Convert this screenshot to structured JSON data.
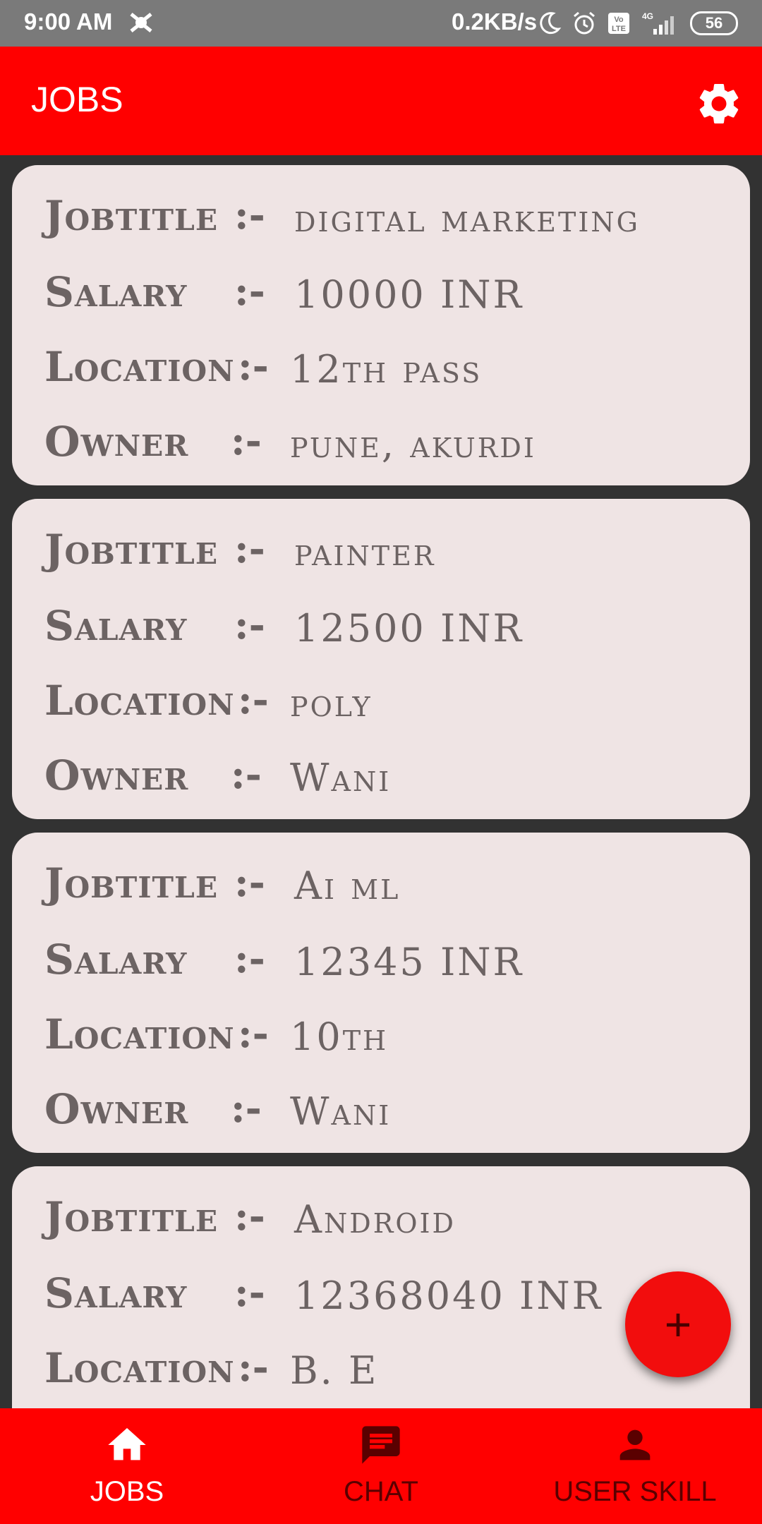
{
  "status_bar": {
    "time": "9:00 AM",
    "speed": "0.2KB/s",
    "battery": "56",
    "network": "4G"
  },
  "app_bar": {
    "title": "JOBS"
  },
  "labels": {
    "jobtitle": "Jobtitle",
    "salary": "Salary",
    "location": "Location",
    "owner": "Owner",
    "separator": ":-"
  },
  "jobs": [
    {
      "jobtitle": "digital marketing",
      "salary": "10000  INR",
      "location": "12th pass",
      "owner": "pune, akurdi"
    },
    {
      "jobtitle": "painter",
      "salary": "12500  INR",
      "location": "poly",
      "owner": "Wani"
    },
    {
      "jobtitle": "Ai ml",
      "salary": "12345  INR",
      "location": "10th",
      "owner": "Wani"
    },
    {
      "jobtitle": "Android",
      "salary": "12368040  INR",
      "location": "B. E"
    }
  ],
  "fab": {
    "label": "+"
  },
  "bottom_nav": [
    {
      "label": "JOBS",
      "icon": "home-icon",
      "active": true
    },
    {
      "label": "CHAT",
      "icon": "chat-icon",
      "active": false
    },
    {
      "label": "USER SKILL",
      "icon": "person-icon",
      "active": false
    }
  ],
  "colors": {
    "primary": "#ff0000",
    "card_bg": "#efe4e4",
    "list_bg": "#323232",
    "text": "#6c6363",
    "nav_active": "#ffffff",
    "nav_inactive": "#5a0000"
  }
}
